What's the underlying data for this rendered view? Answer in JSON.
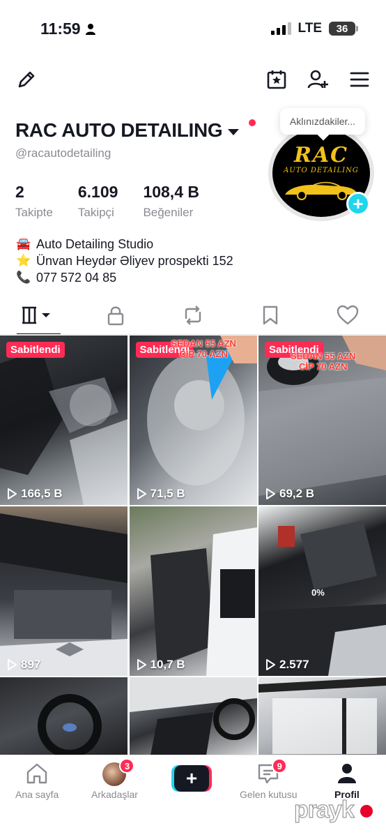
{
  "status": {
    "time": "11:59",
    "network": "LTE",
    "battery": "36"
  },
  "profile": {
    "name": "RAC AUTO DETAILING",
    "username": "@racautodetailing",
    "avatar_logo": "RAC",
    "avatar_logo_sub": "AUTO DETAILING",
    "bubble": "Aklınızdakiler...",
    "stats": [
      {
        "num": "2",
        "label": "Takipte"
      },
      {
        "num": "6.109",
        "label": "Takipçi"
      },
      {
        "num": "108,4 B",
        "label": "Beğeniler"
      }
    ],
    "bio": [
      {
        "emoji": "🚘",
        "text": "Auto Detailing Studio"
      },
      {
        "emoji": "⭐",
        "text": "Ünvan Heydər Əliyev prospekti 152"
      },
      {
        "emoji": "📞",
        "text": "077 572 04 85"
      }
    ]
  },
  "tabs": [
    "grid-icon",
    "lock-icon",
    "repost-icon",
    "bookmark-icon",
    "heart-icon"
  ],
  "videos": [
    {
      "pinned": "Sabitlendi",
      "views": "166,5 B",
      "overlay": ""
    },
    {
      "pinned": "Sabitlendi",
      "views": "71,5 B",
      "overlay": "SEDAN 55 AZN\nCİP 70 AZN"
    },
    {
      "pinned": "Sabitlendi",
      "views": "69,2 B",
      "overlay": "SEDAN 55 AZN\nCİP 70 AZN"
    },
    {
      "pinned": "",
      "views": "897",
      "overlay": ""
    },
    {
      "pinned": "",
      "views": "10,7 B",
      "overlay": ""
    },
    {
      "pinned": "",
      "views": "2.577",
      "overlay": "0%"
    },
    {
      "pinned": "",
      "views": "",
      "overlay": ""
    },
    {
      "pinned": "",
      "views": "",
      "overlay": ""
    },
    {
      "pinned": "",
      "views": "",
      "overlay": ""
    }
  ],
  "nav": {
    "home": "Ana sayfa",
    "friends": "Arkadaşlar",
    "friends_badge": "3",
    "inbox": "Gelen kutusu",
    "inbox_badge": "9",
    "profile": "Profil"
  },
  "watermark": "prayk",
  "colors": {
    "accent": "#fe2c55",
    "cyan": "#20d5ec",
    "text": "#161823",
    "muted": "#8a8b91"
  }
}
